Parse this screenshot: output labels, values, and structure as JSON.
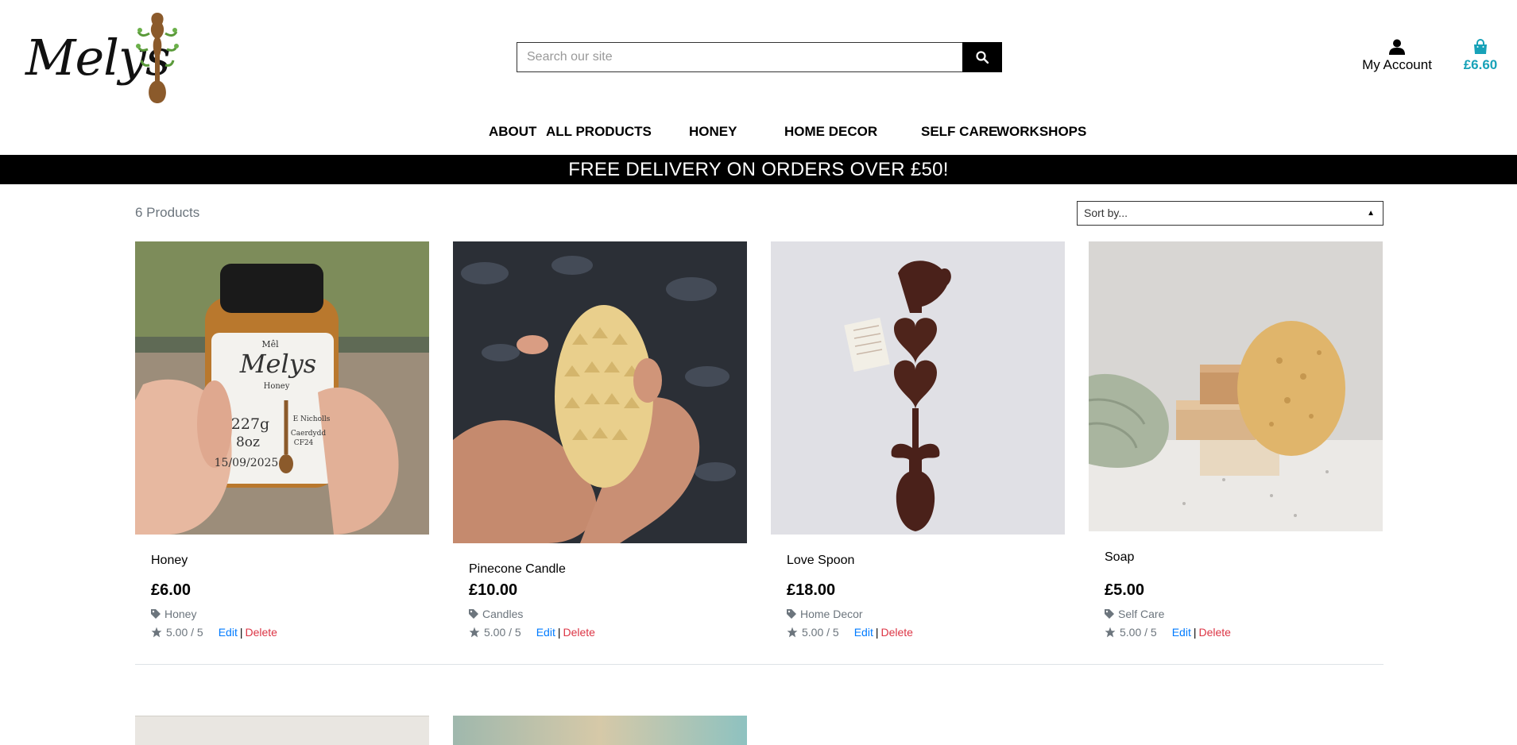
{
  "header": {
    "logo_text": "Melys",
    "search_placeholder": "Search our site",
    "account_label": "My Account",
    "basket_total": "£6.60"
  },
  "nav": {
    "items": [
      "ABOUT",
      "ALL PRODUCTS",
      "HONEY",
      "HOME DECOR",
      "SELF CARE",
      "WORKSHOPS"
    ]
  },
  "banner": {
    "text": "FREE DELIVERY ON ORDERS OVER £50!"
  },
  "listing": {
    "count_text": "6 Products",
    "sort_selected": "Sort by..."
  },
  "labels": {
    "edit": "Edit",
    "separator": "|",
    "delete": "Delete"
  },
  "products": [
    {
      "name": "Honey",
      "price": "£6.00",
      "category": "Honey",
      "rating": "5.00 / 5",
      "image_icon": "honey-jar-photo",
      "label_small": "Mêl",
      "label_brand": "Melys",
      "label_sub": "Honey",
      "label_weight": "227g",
      "label_oz": "8oz",
      "label_maker": "E Nicholls",
      "label_place": "Caerdydd",
      "label_code": "CF24",
      "label_date": "15/09/2025"
    },
    {
      "name": "Pinecone Candle",
      "price": "£10.00",
      "category": "Candles",
      "rating": "5.00 / 5",
      "image_icon": "pinecone-candle-photo"
    },
    {
      "name": "Love Spoon",
      "price": "£18.00",
      "category": "Home Decor",
      "rating": "5.00 / 5",
      "image_icon": "love-spoon-photo"
    },
    {
      "name": "Soap",
      "price": "£5.00",
      "category": "Self Care",
      "rating": "5.00 / 5",
      "image_icon": "soap-photo"
    }
  ],
  "colors": {
    "accent": "#17a2b8",
    "edit": "#007bff",
    "delete": "#dc3545",
    "muted": "#6c757d",
    "banner": "#000000"
  }
}
